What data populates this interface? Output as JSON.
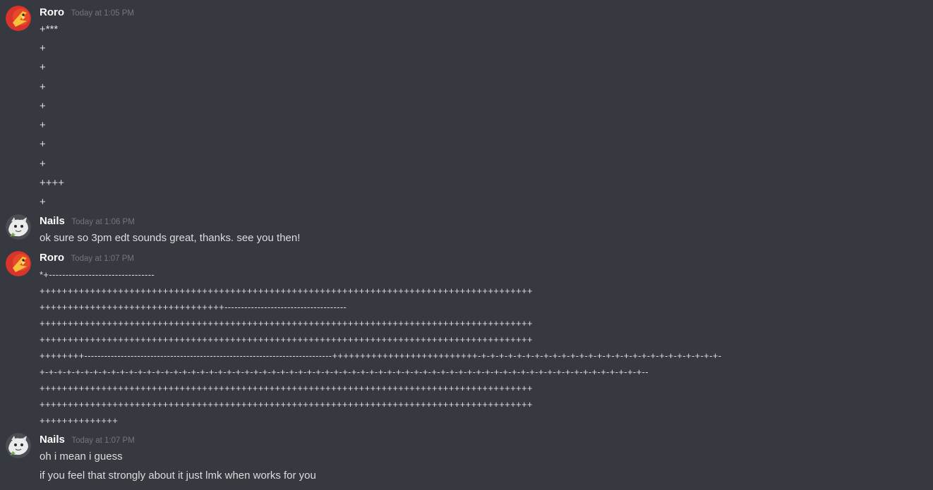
{
  "messages": [
    {
      "author": "Roro",
      "timestamp": "Today at 1:05 PM",
      "lines": [
        "+***",
        "+",
        "+",
        "+",
        "+",
        "+",
        "+",
        "+",
        "++++",
        "+"
      ]
    },
    {
      "author": "Nails",
      "timestamp": "Today at 1:06 PM",
      "lines": [
        "ok sure so 3pm edt sounds great, thanks. see you then!"
      ]
    },
    {
      "author": "Roro",
      "timestamp": "Today at 1:07 PM",
      "lines": [
        "*+--------------------------------",
        "++++++++++++++++++++++++++++++++++++++++++++++++++++++++++++++++++++++++++++++++++++++++",
        "+++++++++++++++++++++++++++++++++-------------------------------------",
        "++++++++++++++++++++++++++++++++++++++++++++++++++++++++++++++++++++++++++++++++++++++++",
        "++++++++++++++++++++++++++++++++++++++++++++++++++++++++++++++++++++++++++++++++++++++++",
        "++++++++---------------------------------------------------------------------------++++++++++++++++++++++++++-+-+-+-+-+-+-+-+-+-+-+-+-+-+-+-+-+-+-+-+-+-+-+-+-+-+-+-",
        "+-+-+-+-+-+-+-+-+-+-+-+-+-+-+-+-+-+-+-+-+-+-+-+-+-+-+-+-+-+-+-+-+-+-+-+-+-+-+-+-+-+-+-+-+-+-+-+-+-+-+-+-+-+-+-+-+-+-+-+-+-+-+-+-+-+-+-+--",
        "++++++++++++++++++++++++++++++++++++++++++++++++++++++++++++++++++++++++++++++++++++++++",
        "++++++++++++++++++++++++++++++++++++++++++++++++++++++++++++++++++++++++++++++++++++++++",
        "++++++++++++++"
      ]
    },
    {
      "author": "Nails",
      "timestamp": "Today at 1:07 PM",
      "lines": [
        "oh i mean i guess",
        "if you feel that strongly about it just lmk when works for you"
      ]
    }
  ],
  "colors": {
    "background": "#36393f",
    "username": "#ffffff",
    "timestamp": "#72767d",
    "message_text": "#dcddde"
  },
  "icons": {
    "roro_avatar": "fire-bird-avatar-icon",
    "nails_avatar": "white-creature-avatar-icon"
  }
}
